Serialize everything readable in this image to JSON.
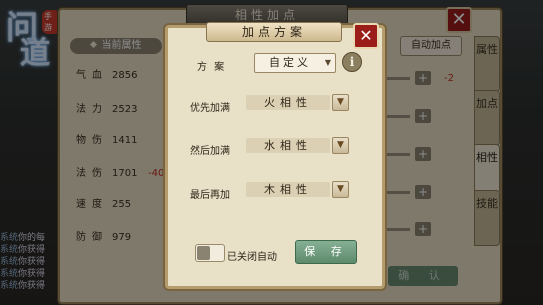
{
  "logo": {
    "line1": "问",
    "line2": "道",
    "tag": "手游"
  },
  "chat": [
    "你的每",
    "你获得",
    "你获得",
    "你获得",
    "你获得"
  ],
  "chat_channel": "系统",
  "outer_panel": {
    "title": "相性加点",
    "current_attr_label": "当前属性",
    "auto_button": "自动加点",
    "confirm_button": "确 认",
    "delta_top": "-2",
    "stats": [
      {
        "name": "气血",
        "value": "2856"
      },
      {
        "name": "法力",
        "value": "2523"
      },
      {
        "name": "物伤",
        "value": "1411"
      },
      {
        "name": "法伤",
        "value": "1701"
      },
      {
        "name": "速度",
        "value": "255"
      },
      {
        "name": "防御",
        "value": "979"
      }
    ],
    "stat_delta": "-40",
    "side_tabs": [
      {
        "label": "属性"
      },
      {
        "label": "加点"
      },
      {
        "label": "相性"
      },
      {
        "label": "技能"
      }
    ],
    "active_tab": 2
  },
  "modal": {
    "title": "加点方案",
    "scheme_label": "方 案",
    "scheme_value": "自定义",
    "rows": [
      {
        "label": "优先加满",
        "value": "火相性"
      },
      {
        "label": "然后加满",
        "value": "水相性"
      },
      {
        "label": "最后再加",
        "value": "木相性"
      }
    ],
    "toggle_label": "已关闭自动",
    "toggle_on": false,
    "save_button": "保 存"
  },
  "colors": {
    "panel_bg": "#e6dcc4",
    "close_red": "#9a1d1a",
    "save_green": "#6e9a7c",
    "negative": "#c03020"
  },
  "icons": {
    "close": "close-icon",
    "info": "info-icon",
    "dropdown": "chevron-down-icon",
    "plus": "plus-icon"
  }
}
